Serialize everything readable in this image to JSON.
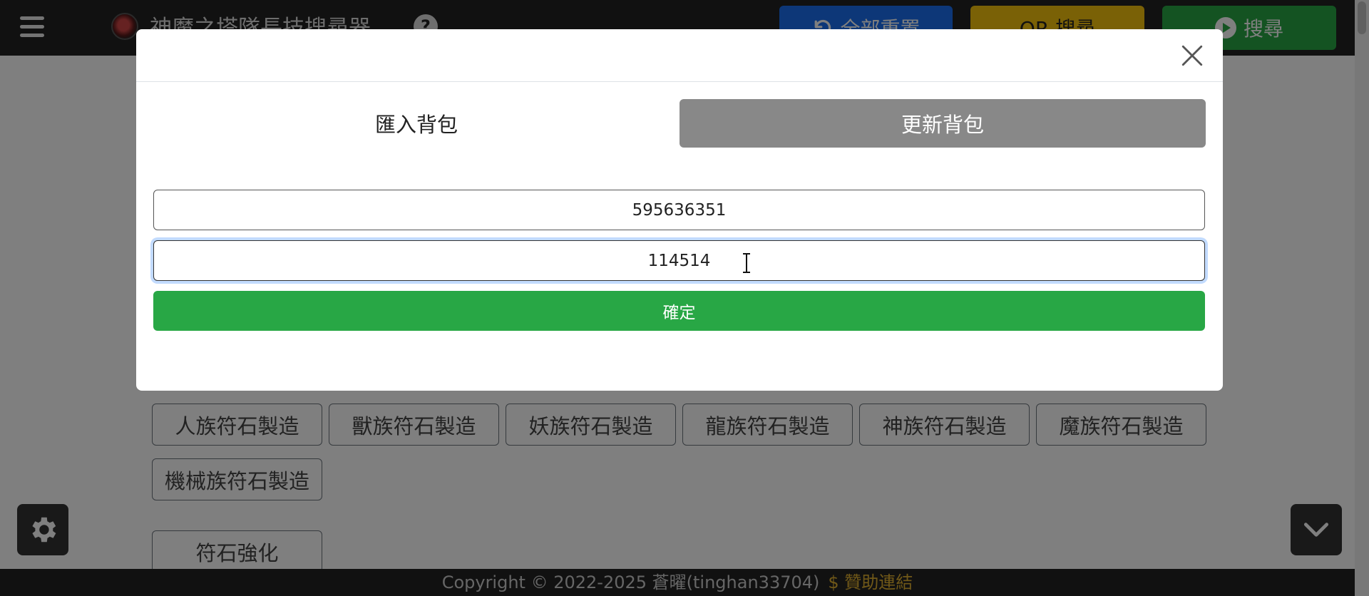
{
  "navbar": {
    "title": "神魔之塔隊長技搜尋器",
    "reset_label": "全部重置",
    "or_label": "OR 搜尋",
    "search_label": "搜尋"
  },
  "craft_buttons": [
    "人族符石製造",
    "獸族符石製造",
    "妖族符石製造",
    "龍族符石製造",
    "神族符石製造",
    "魔族符石製造",
    "機械族符石製造"
  ],
  "enhance_button": "符石強化",
  "footer": {
    "copyright": "Copyright © 2022-2025 蒼曜(tinghan33704)",
    "donate": "$ 贊助連結"
  },
  "modal": {
    "tabs": {
      "import": "匯入背包",
      "update": "更新背包"
    },
    "uid_value": "595636351",
    "code_value": "114514",
    "confirm_label": "確定",
    "active_tab": "update"
  },
  "colors": {
    "primary": "#1a6ff0",
    "warning": "#f4c20d",
    "success": "#28a745",
    "tab_active": "#888888"
  },
  "icons": [
    "hamburger-icon",
    "logo-icon",
    "help-icon",
    "undo-icon",
    "play-icon",
    "close-icon",
    "gear-icon",
    "chevron-down-icon",
    "text-cursor-icon"
  ]
}
